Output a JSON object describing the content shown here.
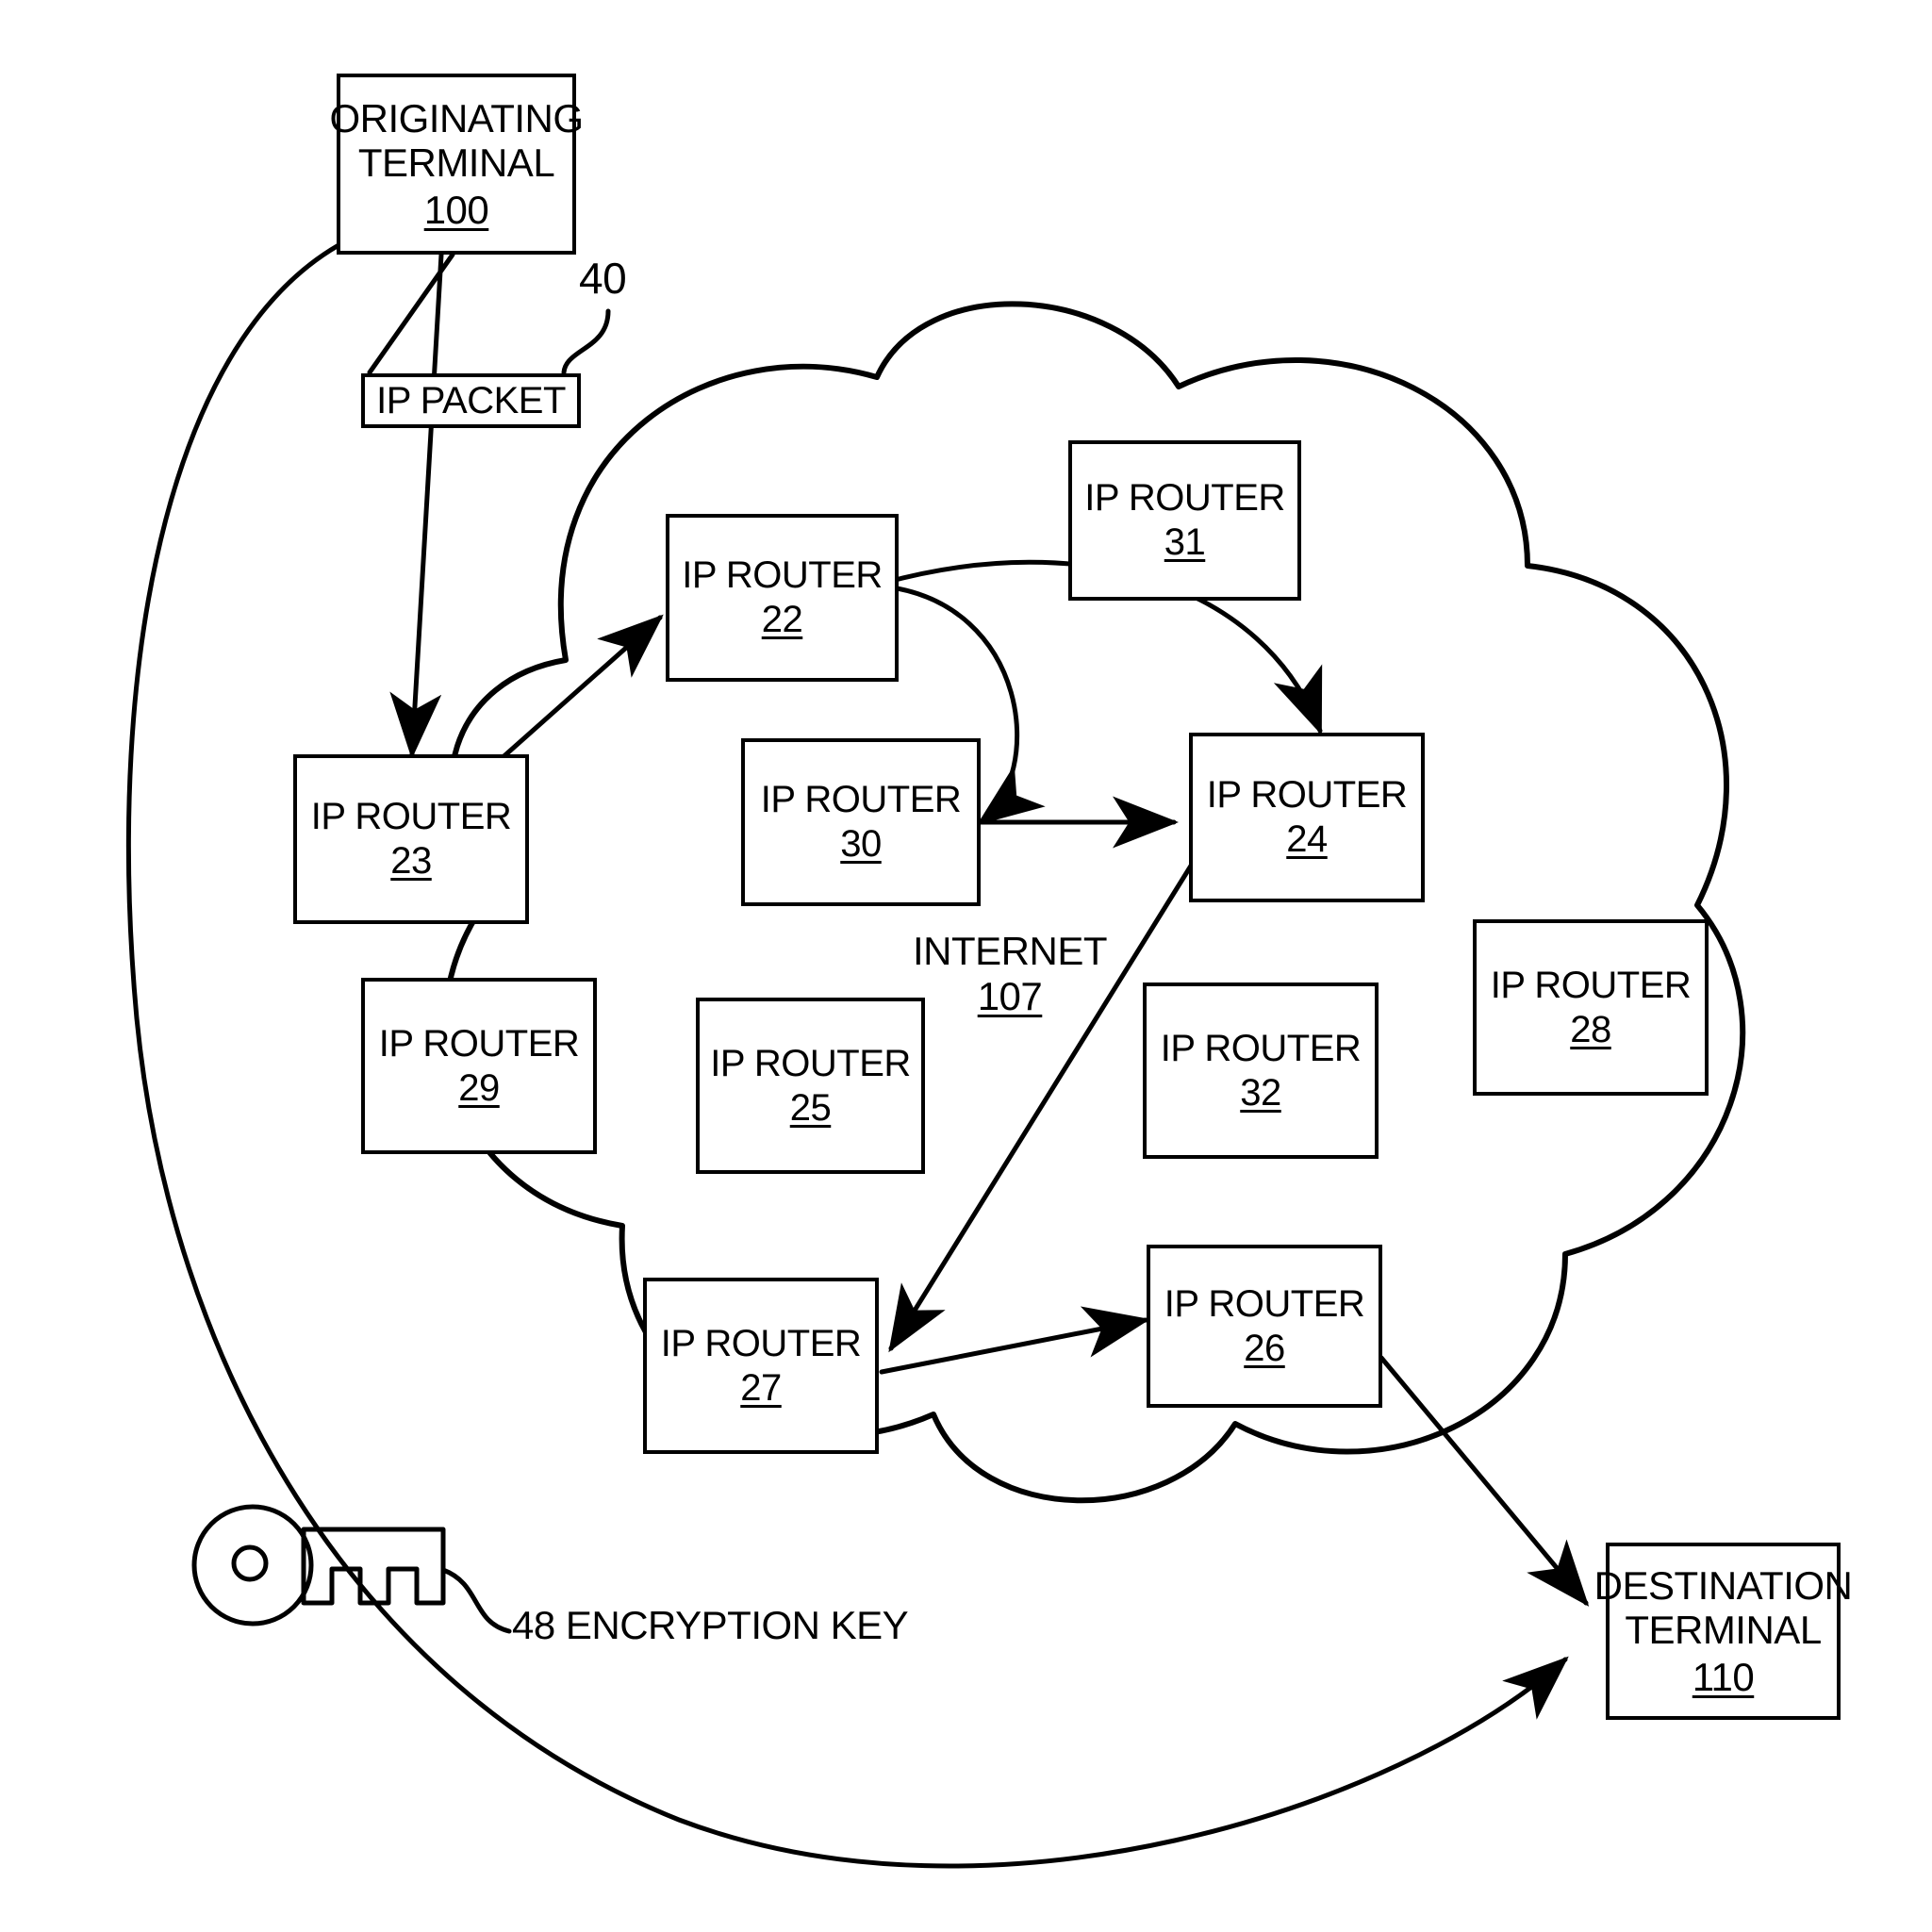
{
  "figure": {
    "title": "IP packet routing through the Internet with encryption key",
    "background_color": "#ffffff",
    "line_color": "#000000"
  },
  "terminals": [
    {
      "id": "originating-terminal",
      "line1": "ORIGINATING",
      "line2": "TERMINAL",
      "ref": "100"
    },
    {
      "id": "destination-terminal",
      "line1": "DESTINATION",
      "line2": "TERMINAL",
      "ref": "110"
    }
  ],
  "packet": {
    "label": "IP PACKET",
    "ref_callout": "40"
  },
  "cloud": {
    "label": "INTERNET",
    "ref": "107"
  },
  "key": {
    "ref": "48",
    "label": "ENCRYPTION KEY",
    "combined": "48 ENCRYPTION KEY"
  },
  "routers": [
    {
      "id": "router-22",
      "label": "IP ROUTER",
      "ref": "22"
    },
    {
      "id": "router-31",
      "label": "IP ROUTER",
      "ref": "31"
    },
    {
      "id": "router-23",
      "label": "IP ROUTER",
      "ref": "23"
    },
    {
      "id": "router-30",
      "label": "IP ROUTER",
      "ref": "30"
    },
    {
      "id": "router-24",
      "label": "IP ROUTER",
      "ref": "24"
    },
    {
      "id": "router-29",
      "label": "IP ROUTER",
      "ref": "29"
    },
    {
      "id": "router-25",
      "label": "IP ROUTER",
      "ref": "25"
    },
    {
      "id": "router-32",
      "label": "IP ROUTER",
      "ref": "32"
    },
    {
      "id": "router-28",
      "label": "IP ROUTER",
      "ref": "28"
    },
    {
      "id": "router-27",
      "label": "IP ROUTER",
      "ref": "27"
    },
    {
      "id": "router-26",
      "label": "IP ROUTER",
      "ref": "26"
    }
  ],
  "connections": [
    {
      "from": "originating-terminal",
      "to": "router-23",
      "via": "IP PACKET",
      "arrow": true
    },
    {
      "from": "router-23",
      "to": "router-22",
      "arrow": true
    },
    {
      "from": "router-22",
      "to": "router-30",
      "arrow": true
    },
    {
      "from": "router-22",
      "to": "router-24",
      "arrow": true
    },
    {
      "from": "router-30",
      "to": "router-24",
      "arrow": true
    },
    {
      "from": "router-24",
      "to": "router-27",
      "arrow": true
    },
    {
      "from": "router-27",
      "to": "router-26",
      "arrow": true
    },
    {
      "from": "router-26",
      "to": "destination-terminal",
      "arrow": true
    },
    {
      "from": "originating-terminal",
      "to": "destination-terminal",
      "via": "encryption-key-path",
      "arrow": true
    }
  ]
}
